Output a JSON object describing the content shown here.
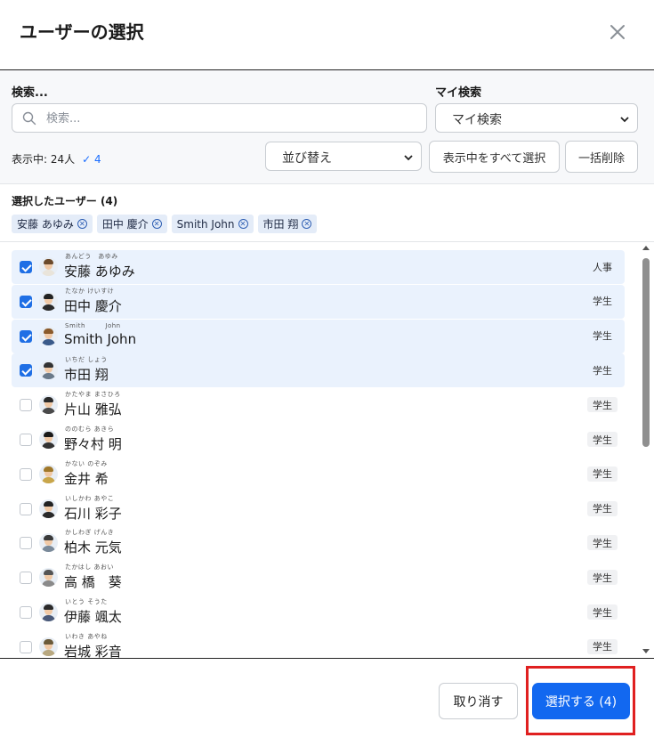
{
  "dialog": {
    "title": "ユーザーの選択"
  },
  "filters": {
    "search_label": "検索...",
    "search_placeholder": "検索...",
    "my_search_label": "マイ検索",
    "my_search_value": "マイ検索",
    "count_text": "表示中: 24人",
    "checked_count": "✓ 4",
    "sort_value": "並び替え",
    "select_all_label": "表示中をすべて選択",
    "bulk_delete_label": "一括削除"
  },
  "selected": {
    "label": "選択したユーザー (4)",
    "chips": [
      "安藤 あゆみ",
      "田中 慶介",
      "Smith John",
      "市田 翔"
    ]
  },
  "users": [
    {
      "ruby": "あんどう　あゆみ",
      "name": "安藤 あゆみ",
      "tag": "人事",
      "selected": true,
      "hair": "#6b4a2b",
      "shirt": "#e9e4da"
    },
    {
      "ruby": "たなか けいすけ",
      "name": "田中 慶介",
      "tag": "学生",
      "selected": true,
      "hair": "#222222",
      "shirt": "#2b2b2b"
    },
    {
      "ruby": "Smith　　　John",
      "name": "Smith John",
      "tag": "学生",
      "selected": true,
      "hair": "#8a5a2b",
      "shirt": "#3a5a8a"
    },
    {
      "ruby": "いちだ しょう",
      "name": "市田 翔",
      "tag": "学生",
      "selected": true,
      "hair": "#333333",
      "shirt": "#6a7a8a"
    },
    {
      "ruby": "かたやま まさひろ",
      "name": "片山 雅弘",
      "tag": "学生",
      "selected": false,
      "hair": "#2a2a2a",
      "shirt": "#4a4a4a"
    },
    {
      "ruby": "ののむら あきら",
      "name": "野々村 明",
      "tag": "学生",
      "selected": false,
      "hair": "#1a1a1a",
      "shirt": "#333333"
    },
    {
      "ruby": "かない のぞみ",
      "name": "金井 希",
      "tag": "学生",
      "selected": false,
      "hair": "#a0782a",
      "shirt": "#c9a64a"
    },
    {
      "ruby": "いしかわ あやこ",
      "name": "石川 彩子",
      "tag": "学生",
      "selected": false,
      "hair": "#222222",
      "shirt": "#2a2a2a"
    },
    {
      "ruby": "かしわぎ げんき",
      "name": "柏木 元気",
      "tag": "学生",
      "selected": false,
      "hair": "#3a3a3a",
      "shirt": "#7a8a9a"
    },
    {
      "ruby": "たかはし あおい",
      "name": "高 橋　葵",
      "tag": "学生",
      "selected": false,
      "hair": "#555555",
      "shirt": "#8a8a8a"
    },
    {
      "ruby": "いとう そうた",
      "name": "伊藤 颯太",
      "tag": "学生",
      "selected": false,
      "hair": "#2a2a2a",
      "shirt": "#4a5a7a"
    },
    {
      "ruby": "いわき あやね",
      "name": "岩城 彩音",
      "tag": "学生",
      "selected": false,
      "hair": "#6a5a3a",
      "shirt": "#b8a880"
    }
  ],
  "footer": {
    "cancel_label": "取り消す",
    "confirm_label": "選択する (4)"
  },
  "colors": {
    "accent": "#1268f0",
    "selected_row": "#eaf2fd",
    "highlight": "#e02020"
  }
}
